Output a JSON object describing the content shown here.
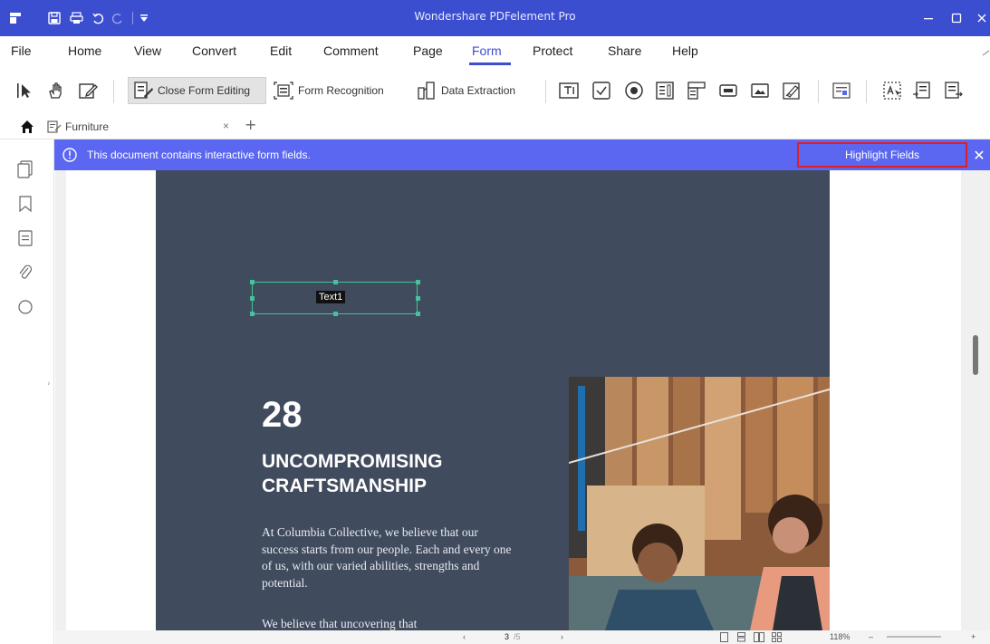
{
  "app": {
    "title": "Wondershare PDFelement Pro"
  },
  "menu": {
    "items": [
      "File",
      "Home",
      "View",
      "Convert",
      "Edit",
      "Comment",
      "Page",
      "Form",
      "Protect",
      "Share",
      "Help"
    ],
    "active": "Form"
  },
  "toolbar": {
    "close_form_editing": "Close Form Editing",
    "form_recognition": "Form Recognition",
    "data_extraction": "Data Extraction"
  },
  "tab": {
    "name": "Furniture",
    "close": "×",
    "new": "+"
  },
  "notification": {
    "message": "This document contains interactive form fields.",
    "highlight_fields": "Highlight Fields",
    "close": "✕"
  },
  "document": {
    "field_label": "Text1",
    "number": "28",
    "heading_line1": "UNCOMPROMISING",
    "heading_line2": "CRAFTSMANSHIP",
    "body": "At Columbia Collective, we believe that our success starts from our people. Each and every one of us, with our varied abilities, strengths and potential.",
    "body2": "We believe that uncovering that"
  },
  "status": {
    "page": "3",
    "page_total": "/5",
    "zoom": "118%"
  },
  "colors": {
    "accent": "#3c4ed0",
    "notify": "#5b67f0",
    "page_bg": "#414b5e",
    "field": "#45c29a",
    "highlight_border": "#e02020"
  }
}
